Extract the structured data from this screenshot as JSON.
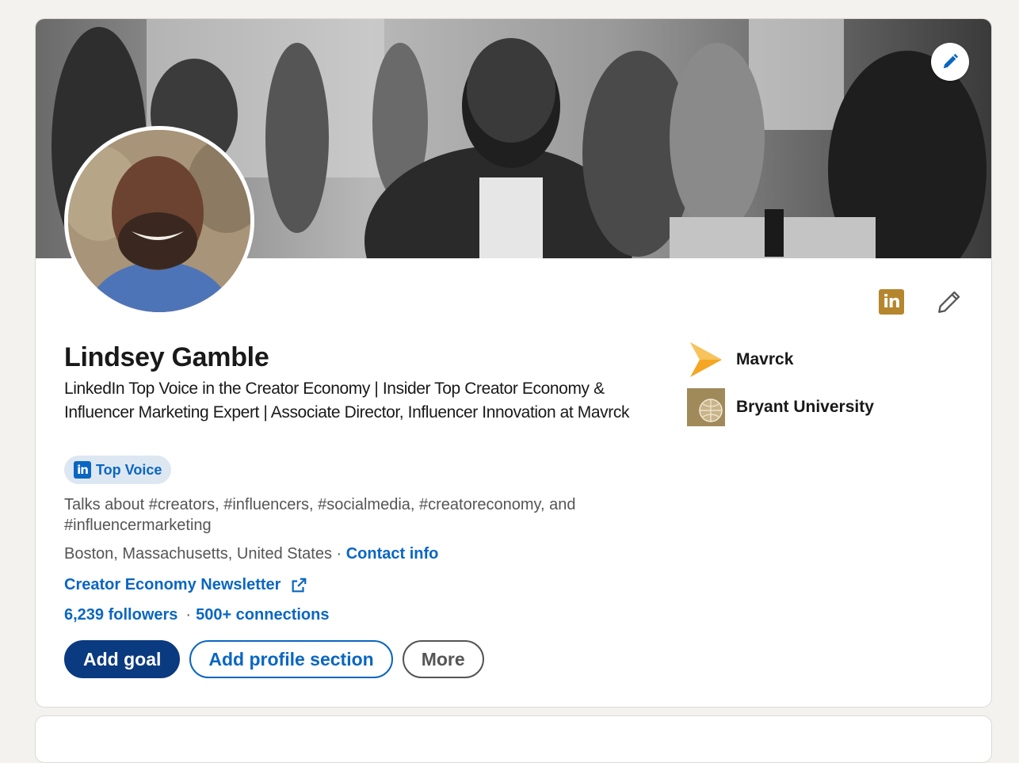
{
  "profile": {
    "name": "Lindsey Gamble",
    "headline": "LinkedIn Top Voice in the Creator Economy | Insider Top Creator Economy & Influencer Marketing Expert | Associate Director, Influencer Innovation at Mavrck",
    "badge": "Top Voice",
    "talks_about": "Talks about #creators, #influencers, #socialmedia, #creatoreconomy, and #influencermarketing",
    "location": "Boston, Massachusetts, United States",
    "location_sep": " · ",
    "contact_info": "Contact info",
    "newsletter": "Creator Economy Newsletter",
    "followers": "6,239 followers",
    "dot": "·",
    "connections": "500+ connections"
  },
  "actions": {
    "add_goal": "Add goal",
    "add_section": "Add profile section",
    "more": "More"
  },
  "right_panel": {
    "items": [
      {
        "label": "Mavrck",
        "icon": "mavrck-logo"
      },
      {
        "label": "Bryant University",
        "icon": "bryant-university-logo"
      }
    ]
  },
  "icons": {
    "linkedin_square_text": "in",
    "badge_li_text": "in"
  },
  "colors": {
    "accent": "#0a66c2",
    "primary_button": "#0a3a80",
    "linkedin_gold": "#b5862e",
    "badge_bg": "#dde7f1"
  }
}
